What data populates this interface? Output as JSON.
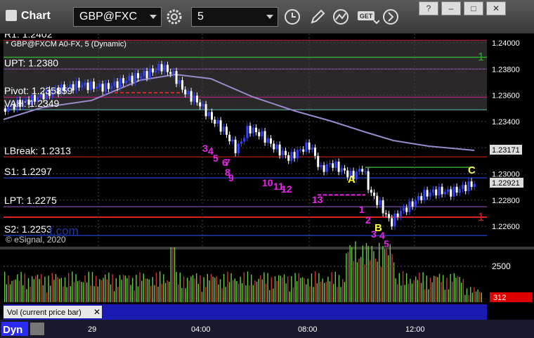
{
  "window": {
    "title": "Chart",
    "win_buttons": [
      "?",
      "–",
      "□",
      "✕"
    ]
  },
  "toolbar": {
    "symbol": "GBP@FXC",
    "interval": "5"
  },
  "chart": {
    "study_label": "* GBP@FXCM A0-FX, 5 (Dynamic)",
    "copyright": "© eSignal, 2020",
    "watermark": "...t.com",
    "levels": [
      {
        "label": "R1: 1.2402",
        "price": 1.2402,
        "color": "#cc2244"
      },
      {
        "label": "UPT: 1.2380",
        "price": 1.238,
        "color": "#9b59d0"
      },
      {
        "label": "Pivot: 1.235859",
        "price": 1.23586,
        "color": "#cc2288"
      },
      {
        "label": "VAH: 1.2349",
        "price": 1.2349,
        "color": "#7fe0e0"
      },
      {
        "label": "LBreak: 1.2313",
        "price": 1.2313,
        "color": "#dd2222"
      },
      {
        "label": "S1: 1.2297",
        "price": 1.2297,
        "color": "#3355ff"
      },
      {
        "label": "LPT: 1.2275",
        "price": 1.2275,
        "color": "#9b59d0"
      },
      {
        "label": "S2: 1.2253",
        "price": 1.2253,
        "color": "#3355ff"
      }
    ],
    "price_ticks": [
      "1.24000",
      "1.23800",
      "1.23600",
      "1.23400",
      "1.23200",
      "1.23000",
      "1.22800",
      "1.22600"
    ],
    "price_tick_values": [
      1.24,
      1.238,
      1.236,
      1.234,
      1.232,
      1.23,
      1.228,
      1.226
    ],
    "current_badge": "1.23171",
    "last_price": "1.22921",
    "annotations": {
      "A": "A",
      "B": "B",
      "C": "C",
      "right_1_top": "1",
      "right_1_bottom": "1"
    },
    "counts_magenta": [
      "3",
      "4",
      "5",
      "6",
      "7",
      "8",
      "9",
      "10",
      "11",
      "12",
      "13",
      "1",
      "2",
      "3",
      "4",
      "5"
    ]
  },
  "volume": {
    "label": "Vol (current price bar)",
    "tick": "2500",
    "last_value": "312"
  },
  "time_axis": {
    "label": "Dyn",
    "ticks": [
      "29",
      "04:00",
      "08:00",
      "12:00"
    ]
  },
  "colors": {
    "up": "#3344ff",
    "down": "#ffffff",
    "ma": "#9a8acb",
    "vol_up": "#66cc44",
    "vol_down": "#cc3333"
  }
}
